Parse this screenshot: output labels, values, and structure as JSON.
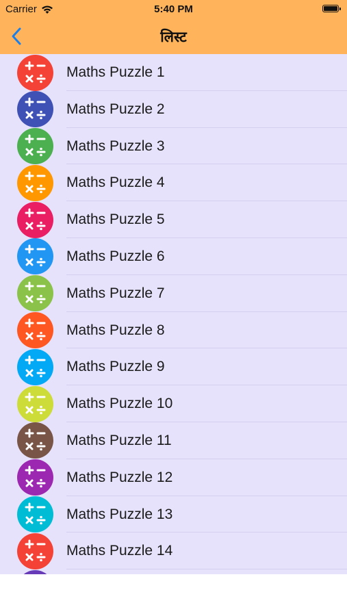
{
  "status": {
    "carrier": "Carrier",
    "time": "5:40 PM"
  },
  "nav": {
    "title": "लिस्ट",
    "back_icon": "chevron-left-icon"
  },
  "colors": {
    "header": "#ffb45c",
    "list_bg": "#e6e2fb",
    "back": "#1a7fe8"
  },
  "puzzles": [
    {
      "label": "Maths Puzzle 1",
      "color": "#f44336"
    },
    {
      "label": "Maths Puzzle 2",
      "color": "#3f51b5"
    },
    {
      "label": "Maths Puzzle 3",
      "color": "#4caf50"
    },
    {
      "label": "Maths Puzzle 4",
      "color": "#ff9800"
    },
    {
      "label": "Maths Puzzle 5",
      "color": "#e91e63"
    },
    {
      "label": "Maths Puzzle 6",
      "color": "#2196f3"
    },
    {
      "label": "Maths Puzzle 7",
      "color": "#8bc34a"
    },
    {
      "label": "Maths Puzzle 8",
      "color": "#ff5722"
    },
    {
      "label": "Maths Puzzle 9",
      "color": "#03a9f4"
    },
    {
      "label": "Maths Puzzle 10",
      "color": "#cddc39"
    },
    {
      "label": "Maths Puzzle 11",
      "color": "#795548"
    },
    {
      "label": "Maths Puzzle 12",
      "color": "#9c27b0"
    },
    {
      "label": "Maths Puzzle 13",
      "color": "#00bcd4"
    },
    {
      "label": "Maths Puzzle 14",
      "color": "#f44336"
    },
    {
      "label": "",
      "color": "#673ab7"
    }
  ]
}
